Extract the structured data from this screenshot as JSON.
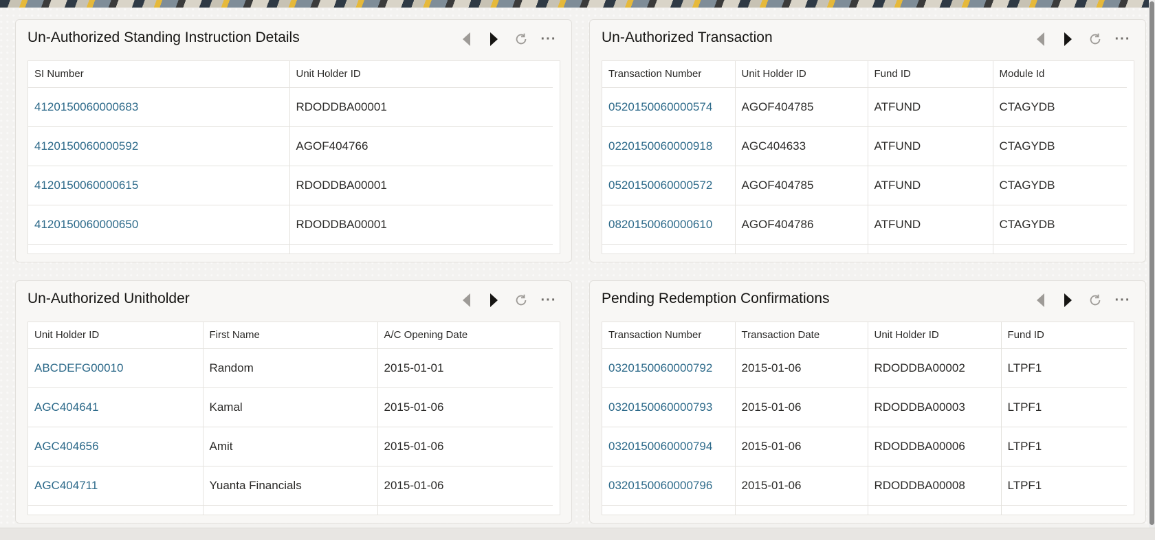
{
  "panels": [
    {
      "title": "Un-Authorized Standing Instruction Details",
      "columns": [
        "SI Number",
        "Unit Holder ID"
      ],
      "rows": [
        [
          "4120150060000683",
          "RDODDBA00001"
        ],
        [
          "4120150060000592",
          "AGOF404766"
        ],
        [
          "4120150060000615",
          "RDODDBA00001"
        ],
        [
          "4120150060000650",
          "RDODDBA00001"
        ]
      ]
    },
    {
      "title": "Un-Authorized Transaction",
      "columns": [
        "Transaction Number",
        "Unit Holder ID",
        "Fund ID",
        "Module Id"
      ],
      "rows": [
        [
          "0520150060000574",
          "AGOF404785",
          "ATFUND",
          "CTAGYDB"
        ],
        [
          "0220150060000918",
          "AGC404633",
          "ATFUND",
          "CTAGYDB"
        ],
        [
          "0520150060000572",
          "AGOF404785",
          "ATFUND",
          "CTAGYDB"
        ],
        [
          "0820150060000610",
          "AGOF404786",
          "ATFUND",
          "CTAGYDB"
        ]
      ]
    },
    {
      "title": "Un-Authorized Unitholder",
      "columns": [
        "Unit Holder ID",
        "First Name",
        "A/C Opening Date"
      ],
      "rows": [
        [
          "ABCDEFG00010",
          "Random",
          "2015-01-01"
        ],
        [
          "AGC404641",
          "Kamal",
          "2015-01-06"
        ],
        [
          "AGC404656",
          "Amit",
          "2015-01-06"
        ],
        [
          "AGC404711",
          "Yuanta Financials",
          "2015-01-06"
        ]
      ]
    },
    {
      "title": "Pending Redemption Confirmations",
      "columns": [
        "Transaction Number",
        "Transaction Date",
        "Unit Holder ID",
        "Fund ID"
      ],
      "rows": [
        [
          "0320150060000792",
          "2015-01-06",
          "RDODDBA00002",
          "LTPF1"
        ],
        [
          "0320150060000793",
          "2015-01-06",
          "RDODDBA00003",
          "LTPF1"
        ],
        [
          "0320150060000794",
          "2015-01-06",
          "RDODDBA00006",
          "LTPF1"
        ],
        [
          "0320150060000796",
          "2015-01-06",
          "RDODDBA00008",
          "LTPF1"
        ]
      ]
    }
  ],
  "icons": {
    "prev": "chevron-left-icon",
    "next": "chevron-right-icon",
    "refresh": "refresh-icon",
    "more": "more-options-icon"
  },
  "colors": {
    "link": "#2d6a8a",
    "text": "#2b2a28",
    "card_bg": "#f8f7f5"
  }
}
